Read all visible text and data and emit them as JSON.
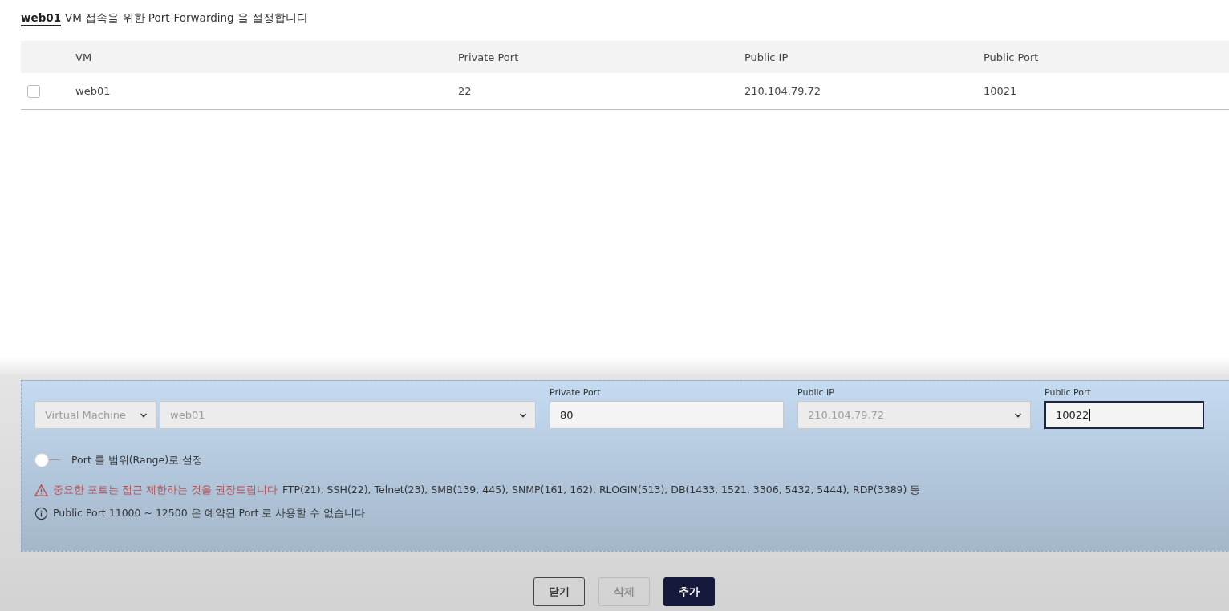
{
  "heading": {
    "vm_name": "web01",
    "text": "VM 접속을 위한 Port-Forwarding 을 설정합니다"
  },
  "table": {
    "columns": [
      "VM",
      "Private Port",
      "Public IP",
      "Public Port"
    ],
    "rows": [
      {
        "checked": false,
        "cells": [
          "web01",
          "22",
          "210.104.79.72",
          "10021"
        ]
      }
    ]
  },
  "form": {
    "fields": [
      {
        "kind": "select",
        "value": "Virtual Machine",
        "disabled": true,
        "focused": false
      },
      {
        "kind": "select",
        "value": "web01",
        "disabled": true,
        "focused": false
      },
      {
        "kind": "input",
        "label": "Private Port",
        "value": "80",
        "disabled": false,
        "focused": false
      },
      {
        "kind": "select",
        "label": "Public IP",
        "value": "210.104.79.72",
        "disabled": true,
        "focused": false
      },
      {
        "kind": "input",
        "label": "Public Port",
        "value": "10022",
        "disabled": false,
        "focused": true
      }
    ],
    "range_toggle": {
      "label": "Port 를 범위(Range)로 설정",
      "on": false
    },
    "warning": {
      "title": "중요한 포트는 접근 제한하는 것을 권장드립니다",
      "text": "FTP(21), SSH(22), Telnet(23), SMB(139, 445), SNMP(161, 162), RLOGIN(513), DB(1433, 1521, 3306, 5432, 5444), RDP(3389) 등"
    },
    "info": "Public Port 11000 ~ 12500 은 예약된 Port 로 사용할 수 없습니다"
  },
  "buttons": [
    {
      "label": "닫기",
      "kind": "outline",
      "disabled": false
    },
    {
      "label": "삭제",
      "kind": "outline",
      "disabled": true
    },
    {
      "label": "추가",
      "kind": "primary",
      "disabled": false
    }
  ]
}
